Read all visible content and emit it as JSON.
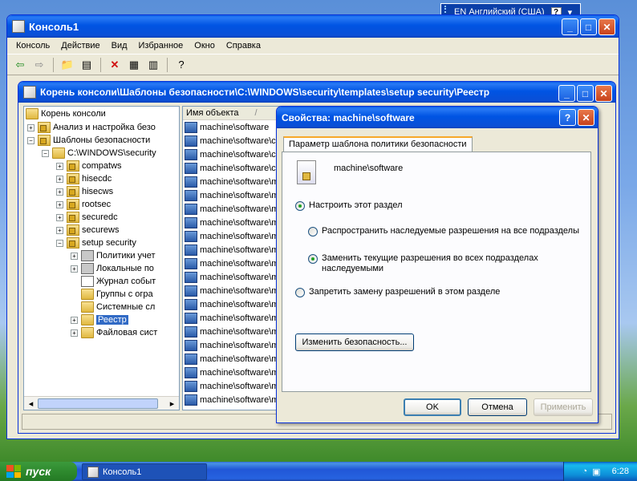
{
  "langbar": {
    "lang": "EN Английский (США)",
    "help": "?"
  },
  "main": {
    "title": "Консоль1",
    "menu": [
      "Консоль",
      "Действие",
      "Вид",
      "Избранное",
      "Окно",
      "Справка"
    ]
  },
  "inner": {
    "title": "Корень консоли\\Шаблоны безопасности\\C:\\WINDOWS\\security\\templates\\setup security\\Реестр",
    "tree": [
      {
        "label": "Корень консоли"
      },
      {
        "label": "Анализ и настройка безо"
      },
      {
        "label": "Шаблоны безопасности"
      },
      {
        "label": "C:\\WINDOWS\\security"
      },
      {
        "label": "compatws"
      },
      {
        "label": "hisecdc"
      },
      {
        "label": "hisecws"
      },
      {
        "label": "rootsec"
      },
      {
        "label": "securedc"
      },
      {
        "label": "securews"
      },
      {
        "label": "setup security"
      },
      {
        "label": "Политики учет"
      },
      {
        "label": "Локальные по"
      },
      {
        "label": "Журнал событ"
      },
      {
        "label": "Группы с огра"
      },
      {
        "label": "Системные сл"
      },
      {
        "label": "Реестр"
      },
      {
        "label": "Файловая сист"
      }
    ],
    "list_header": "Имя объекта",
    "rows": [
      "machine\\software",
      "machine\\software\\classe",
      "machine\\software\\classe",
      "machine\\software\\classe",
      "machine\\software\\micros",
      "machine\\software\\micros",
      "machine\\software\\micros",
      "machine\\software\\micros",
      "machine\\software\\micros",
      "machine\\software\\micros",
      "machine\\software\\micros",
      "machine\\software\\micros",
      "machine\\software\\micros",
      "machine\\software\\micros",
      "machine\\software\\micros",
      "machine\\software\\micros",
      "machine\\software\\micros",
      "machine\\software\\micros",
      "machine\\software\\micros",
      "machine\\software\\micros",
      "machine\\software\\micros"
    ]
  },
  "dialog": {
    "title": "Свойства: machine\\software",
    "tab": "Параметр шаблона политики безопасности",
    "object_name": "machine\\software",
    "opt_configure": "Настроить этот раздел",
    "opt_propagate": "Распространить наследуемые разрешения на все подразделы",
    "opt_replace": "Заменить текущие разрешения во всех подразделах наследуемыми",
    "opt_deny": "Запретить замену разрешений в этом разделе",
    "edit_security": "Изменить безопасность...",
    "ok": "OK",
    "cancel": "Отмена",
    "apply": "Применить"
  },
  "taskbar": {
    "start": "пуск",
    "task": "Консоль1",
    "clock": "6:28"
  }
}
